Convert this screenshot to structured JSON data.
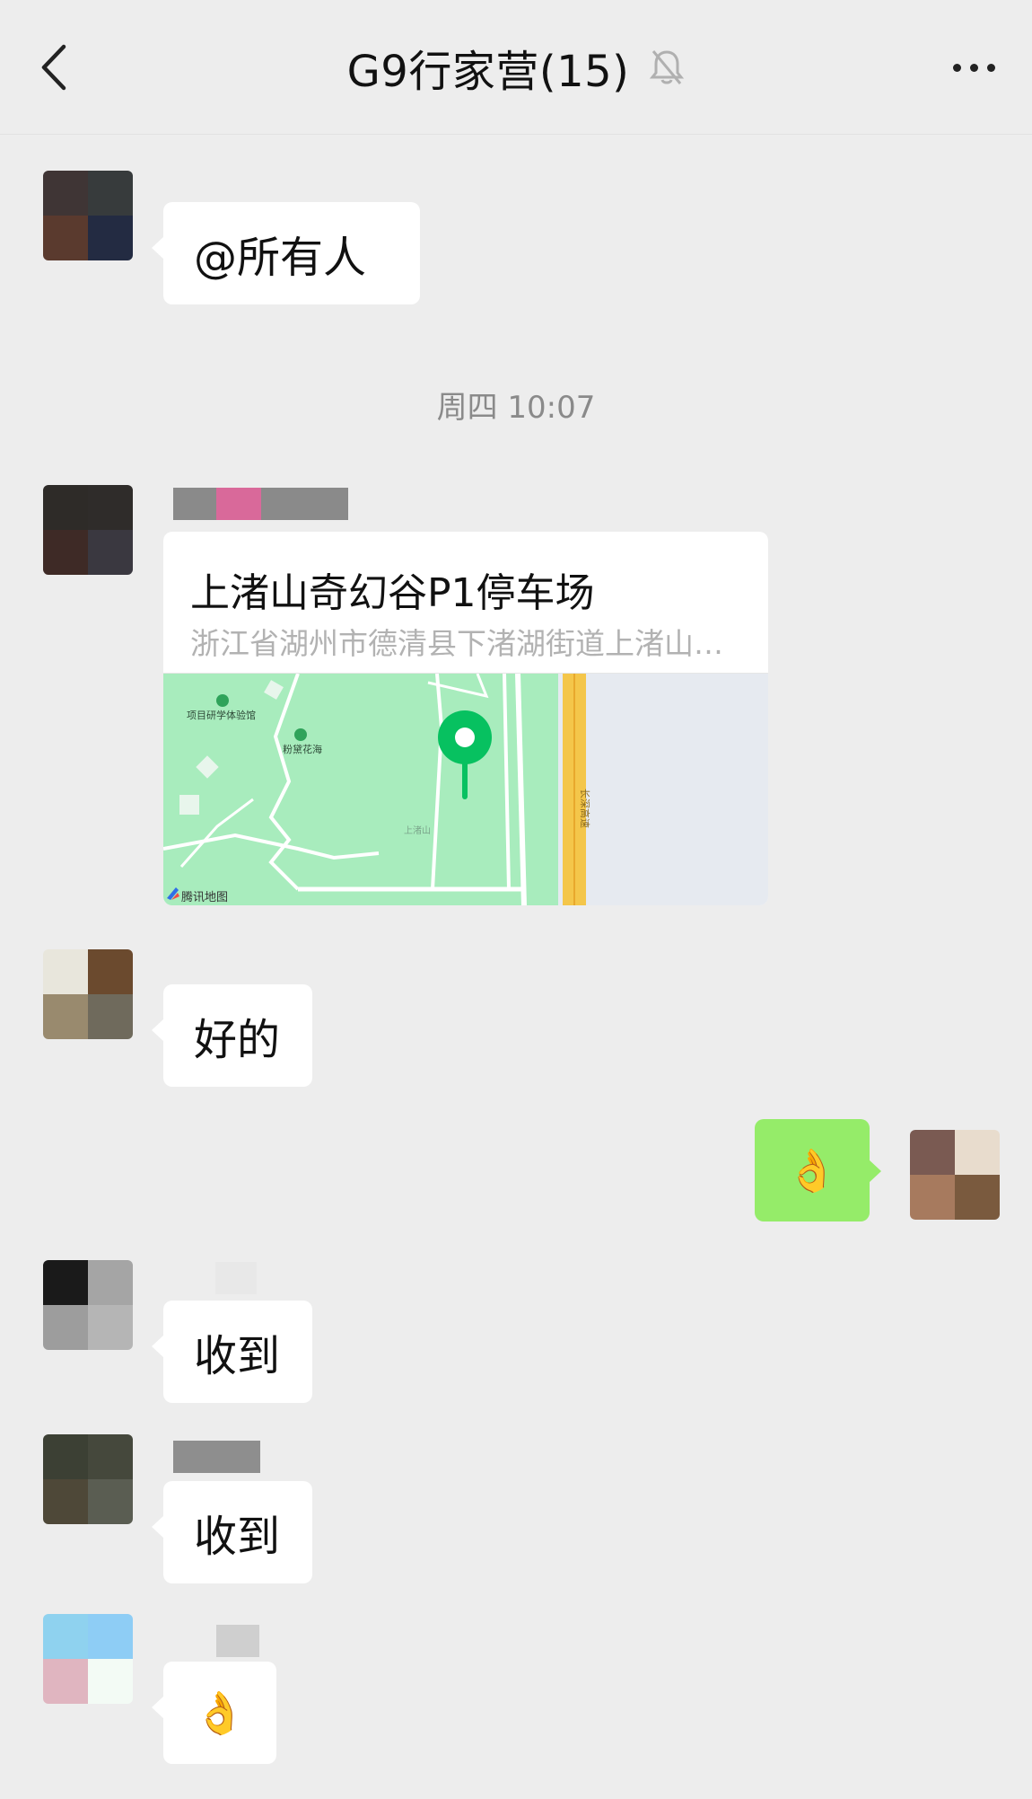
{
  "header": {
    "title": "G9行家营(15)",
    "back_icon": "chevron-left-icon",
    "mute_icon": "bell-off-icon",
    "more_icon": "more-horizontal-icon"
  },
  "messages": [
    {
      "type": "text",
      "side": "left",
      "text": "@所有人"
    },
    {
      "type": "timestamp",
      "text": "周四 10:07"
    },
    {
      "type": "location",
      "side": "left",
      "title": "上渚山奇幻谷P1停车场",
      "address": "浙江省湖州市德清县下渚湖街道上渚山…",
      "map": {
        "labels": [
          "项目研学体验馆",
          "粉黛花海",
          "上渚山",
          "长深高速"
        ],
        "provider": "腾讯地图"
      }
    },
    {
      "type": "text",
      "side": "left",
      "text": "好的"
    },
    {
      "type": "emoji",
      "side": "right",
      "text": "👌"
    },
    {
      "type": "text",
      "side": "left",
      "text": "收到"
    },
    {
      "type": "text",
      "side": "left",
      "text": "收到"
    },
    {
      "type": "emoji",
      "side": "left",
      "text": "👌"
    }
  ],
  "colors": {
    "background": "#ededed",
    "bubble_incoming": "#ffffff",
    "bubble_outgoing": "#95ec69",
    "map_green": "#a8ecbd",
    "map_pin": "#07c160",
    "highway": "#f4c64a"
  }
}
